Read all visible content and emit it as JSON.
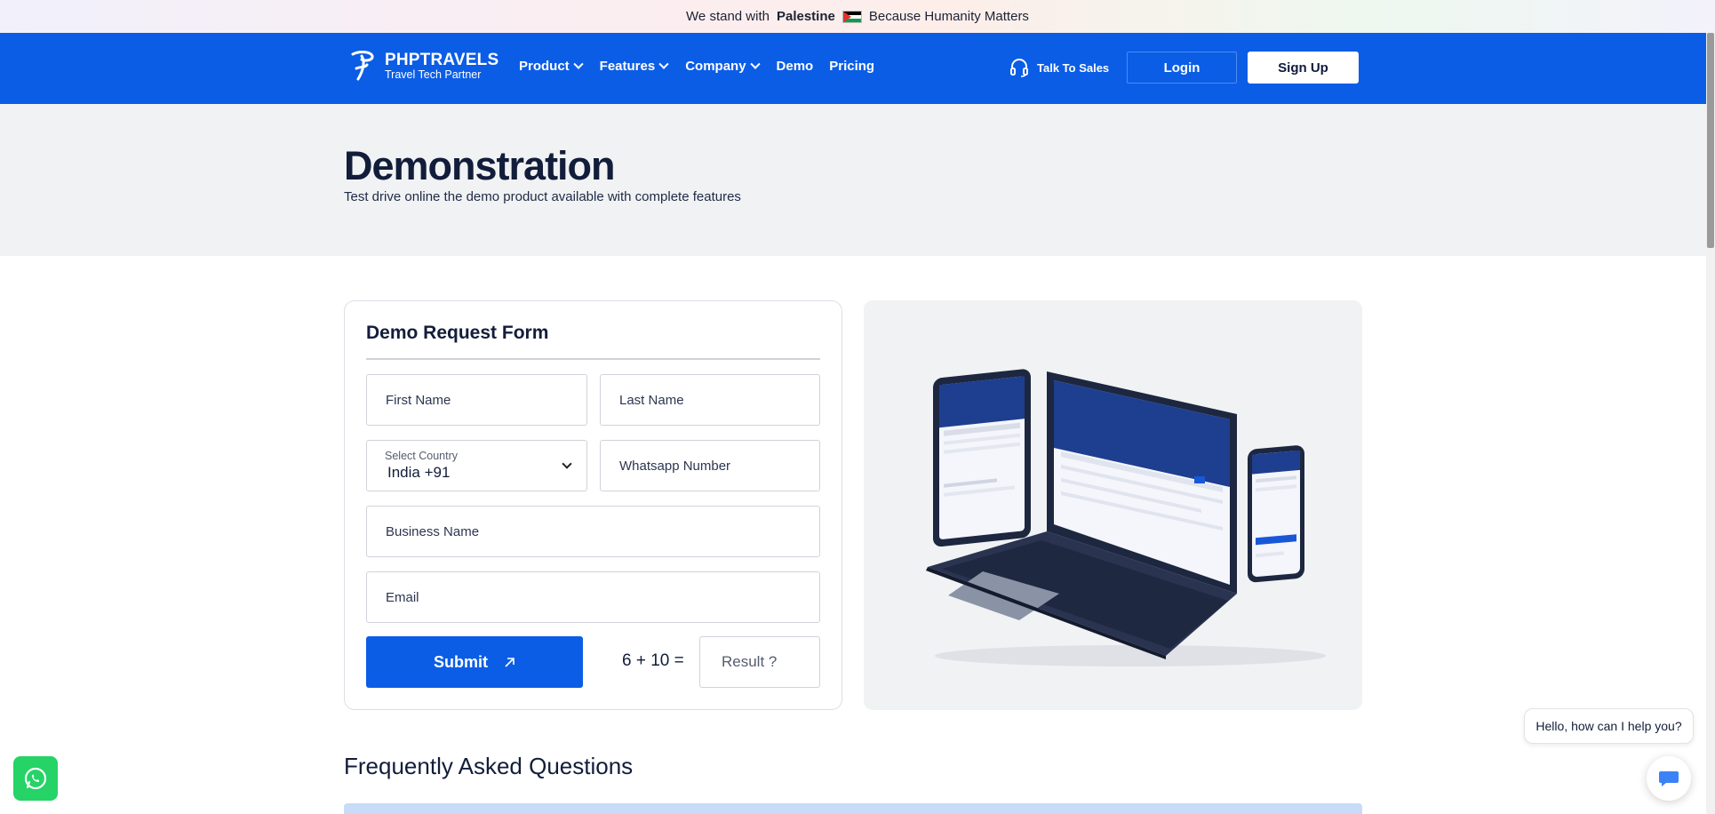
{
  "announcement": {
    "prefix": "We stand with",
    "country": "Palestine",
    "suffix": "Because Humanity Matters"
  },
  "nav": {
    "brand_title": "PHPTRAVELS",
    "brand_sub": "Travel Tech Partner",
    "menu": [
      {
        "label": "Product",
        "dropdown": true
      },
      {
        "label": "Features",
        "dropdown": true
      },
      {
        "label": "Company",
        "dropdown": true
      },
      {
        "label": "Demo",
        "dropdown": false
      },
      {
        "label": "Pricing",
        "dropdown": false
      }
    ],
    "talk_to_sales": "Talk To Sales",
    "login": "Login",
    "signup": "Sign Up",
    "brand_color": "#0b5de6"
  },
  "hero": {
    "title": "Demonstration",
    "subtitle": "Test drive online the demo product available with complete features"
  },
  "form": {
    "title": "Demo Request Form",
    "first_name_placeholder": "First Name",
    "last_name_placeholder": "Last Name",
    "country_label": "Select Country",
    "country_value": "India +91",
    "whatsapp_placeholder": "Whatsapp Number",
    "business_placeholder": "Business Name",
    "email_placeholder": "Email",
    "submit_label": "Submit",
    "captcha_question": "6 + 10 =",
    "result_placeholder": "Result ?"
  },
  "faq": {
    "title": "Frequently Asked Questions"
  },
  "chat": {
    "bubble": "Hello, how can I help you?"
  },
  "icons": [
    "phptravels-logo-icon",
    "chevron-down-icon",
    "headset-icon",
    "external-arrow-icon",
    "whatsapp-icon",
    "chat-icon"
  ]
}
